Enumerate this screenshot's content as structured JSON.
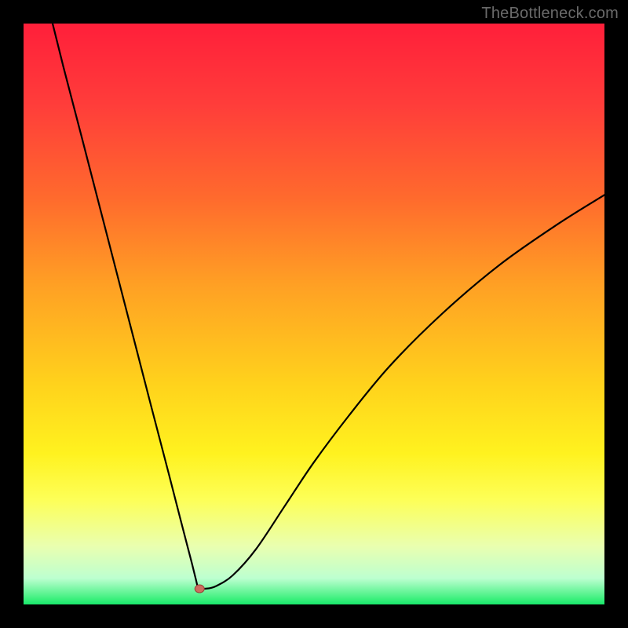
{
  "watermark": {
    "text": "TheBottleneck.com"
  },
  "colors": {
    "frame": "#000000",
    "curve": "#000000",
    "marker_fill": "#cc6d5f",
    "marker_stroke": "#9a4338"
  },
  "chart_data": {
    "type": "line",
    "title": "",
    "xlabel": "",
    "ylabel": "",
    "xlim": [
      0,
      100
    ],
    "ylim": [
      0,
      100
    ],
    "gradient_stops": [
      {
        "offset": 0,
        "color": "#ff1f3a"
      },
      {
        "offset": 0.14,
        "color": "#ff3d3a"
      },
      {
        "offset": 0.3,
        "color": "#ff6a2d"
      },
      {
        "offset": 0.45,
        "color": "#ffa024"
      },
      {
        "offset": 0.62,
        "color": "#ffd21c"
      },
      {
        "offset": 0.74,
        "color": "#fff21f"
      },
      {
        "offset": 0.82,
        "color": "#fdff58"
      },
      {
        "offset": 0.9,
        "color": "#e9ffb0"
      },
      {
        "offset": 0.955,
        "color": "#bdffd0"
      },
      {
        "offset": 0.99,
        "color": "#3ef07e"
      },
      {
        "offset": 1.0,
        "color": "#18e86b"
      }
    ],
    "series": [
      {
        "name": "bottleneck-curve",
        "x": [
          5,
          7,
          10,
          14,
          18,
          22,
          25,
          27,
          28.3,
          29,
          29.6,
          30,
          30.3,
          31.2,
          33,
          36,
          40,
          45,
          50,
          56,
          63,
          72,
          82,
          92,
          100
        ],
        "y": [
          100,
          92,
          80.5,
          65,
          49.5,
          34,
          22.5,
          14.7,
          9.7,
          7,
          4.6,
          3,
          2.7,
          2.7,
          3.1,
          5,
          9.5,
          17,
          24.5,
          32.5,
          41,
          50,
          58.5,
          65.5,
          70.5
        ]
      }
    ],
    "marker": {
      "x": 30.3,
      "y": 2.7,
      "rx": 6,
      "ry": 5
    },
    "notes": "Values are percentages read off the plot area; gradient runs top (red) to bottom (green)."
  }
}
